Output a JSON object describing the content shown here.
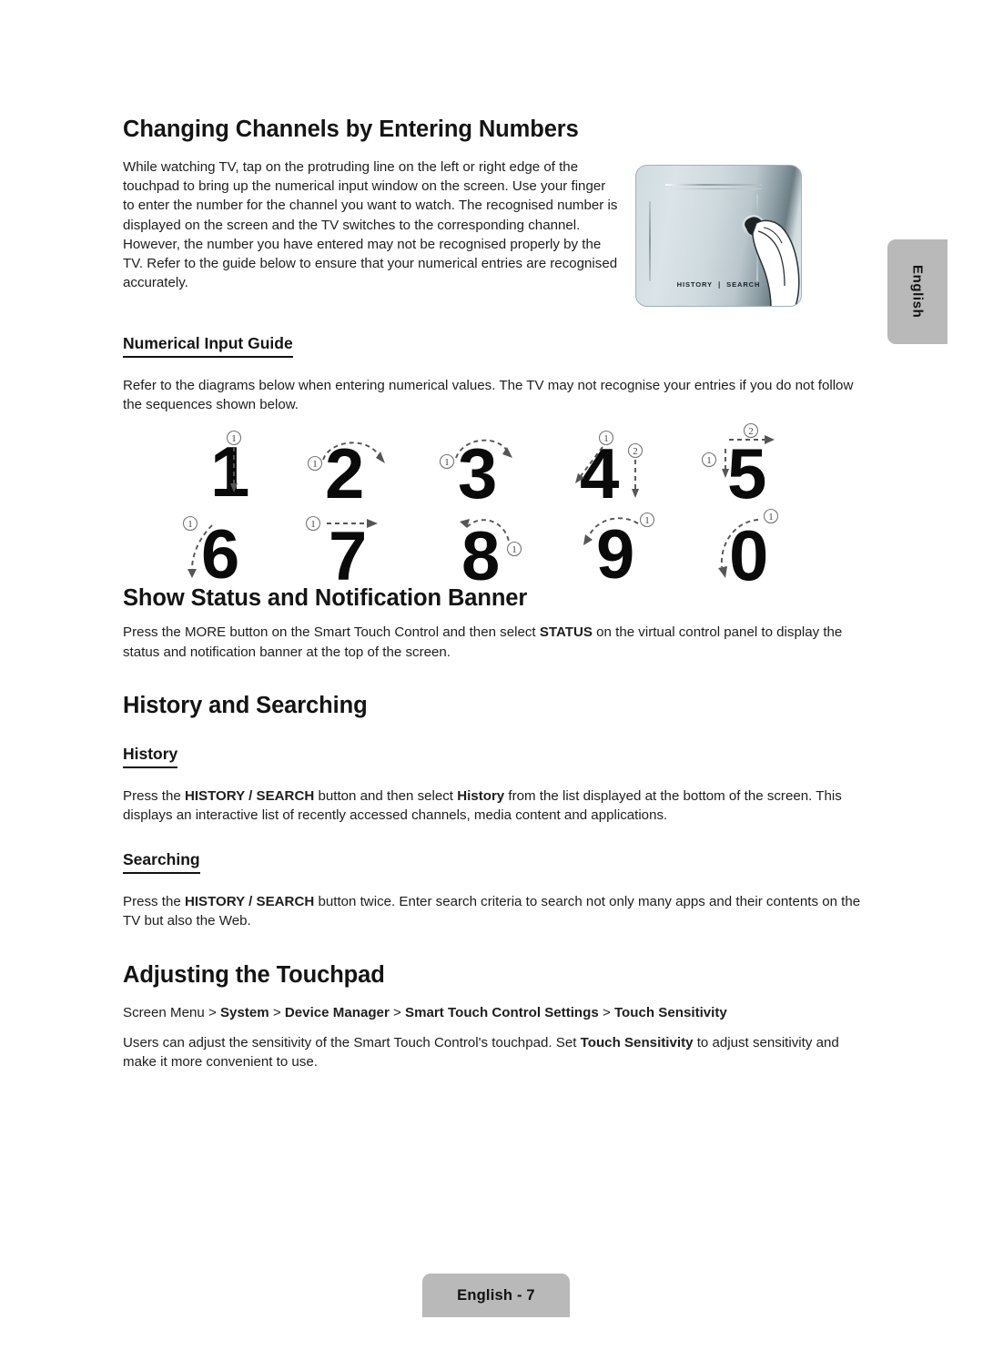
{
  "page": {
    "language_tab": "English",
    "footer_label": "English - 7"
  },
  "sections": [
    {
      "id": "changing-channels",
      "heading": "Changing Channels by Entering Numbers",
      "paragraph": "While watching TV, tap on the protruding line on the left or right edge of the touchpad to bring up the numerical input window on the screen. Use your finger to enter the number for the channel you want to watch. The recognised number is displayed on the screen and the TV switches to the corresponding channel. However, the number you have entered may not be recognised properly by the TV. Refer to the guide below to ensure that your numerical entries are recognised accurately."
    },
    {
      "id": "numerical-input-guide",
      "subheading": "Numerical Input Guide",
      "paragraph": "Refer to the diagrams below when entering numerical values. The TV may not recognise your entries if you do not follow the sequences shown below."
    },
    {
      "id": "show-status",
      "heading": "Show Status and Notification Banner",
      "paragraph_parts": [
        {
          "text": "Press the ",
          "bold": false
        },
        {
          "text": "MORE",
          "bold": false
        },
        {
          "text": " button on the Smart Touch Control and then select ",
          "bold": false
        },
        {
          "text": "STATUS",
          "bold": true
        },
        {
          "text": " on the virtual control panel to display the status and notification banner at the top of the screen.",
          "bold": false
        }
      ]
    },
    {
      "id": "history-and-searching",
      "heading": "History and Searching"
    },
    {
      "id": "history",
      "subheading": "History",
      "paragraph_parts": [
        {
          "text": "Press the ",
          "bold": false
        },
        {
          "text": "HISTORY / SEARCH",
          "bold": true
        },
        {
          "text": " button and then select ",
          "bold": false
        },
        {
          "text": "History",
          "bold": true
        },
        {
          "text": " from the list displayed at the bottom of the screen. This displays an interactive list of recently accessed channels, media content and applications.",
          "bold": false
        }
      ]
    },
    {
      "id": "searching",
      "subheading": "Searching",
      "paragraph_parts": [
        {
          "text": "Press the ",
          "bold": false
        },
        {
          "text": "HISTORY / SEARCH",
          "bold": true
        },
        {
          "text": " button twice. Enter search criteria to search not only many apps and their contents on the TV but also the Web.",
          "bold": false
        }
      ]
    },
    {
      "id": "adjusting-touchpad",
      "heading": "Adjusting the Touchpad",
      "menu_path_parts": [
        {
          "text": "Screen Menu",
          "bold": false
        },
        {
          "text": " > ",
          "bold": false
        },
        {
          "text": "System",
          "bold": true
        },
        {
          "text": " > ",
          "bold": false
        },
        {
          "text": "Device Manager",
          "bold": true
        },
        {
          "text": " > ",
          "bold": false
        },
        {
          "text": "Smart Touch Control Settings",
          "bold": true
        },
        {
          "text": " > ",
          "bold": false
        },
        {
          "text": "Touch Sensitivity",
          "bold": true
        }
      ],
      "paragraph_parts": [
        {
          "text": "Users can adjust the sensitivity of the Smart Touch Control's touchpad. Set ",
          "bold": false
        },
        {
          "text": "Touch Sensitivity",
          "bold": true
        },
        {
          "text": " to adjust sensitivity and make it more convenient to use.",
          "bold": false
        }
      ]
    }
  ],
  "touchpad_illustration": {
    "label": "HISTORY   SEARCH",
    "label_left": "HISTORY",
    "label_separator": "❘",
    "label_right": "SEARCH"
  },
  "stroke_diagrams": {
    "row1": [
      {
        "digit": "1",
        "strokes": [
          "①"
        ]
      },
      {
        "digit": "2",
        "strokes": [
          "①"
        ]
      },
      {
        "digit": "3",
        "strokes": [
          "①"
        ]
      },
      {
        "digit": "4",
        "strokes": [
          "①",
          "②"
        ]
      },
      {
        "digit": "5",
        "strokes": [
          "①",
          "②"
        ]
      }
    ],
    "row2": [
      {
        "digit": "6",
        "strokes": [
          "①"
        ]
      },
      {
        "digit": "7",
        "strokes": [
          "①"
        ]
      },
      {
        "digit": "8",
        "strokes": [
          "①"
        ]
      },
      {
        "digit": "9",
        "strokes": [
          "①"
        ]
      },
      {
        "digit": "0",
        "strokes": [
          "①"
        ]
      }
    ]
  },
  "colors": {
    "tab_gray": "#b9b9b9",
    "text": "#1a1a1a",
    "pad_light": "#dbe4e8",
    "pad_dark": "#6d7d85"
  }
}
